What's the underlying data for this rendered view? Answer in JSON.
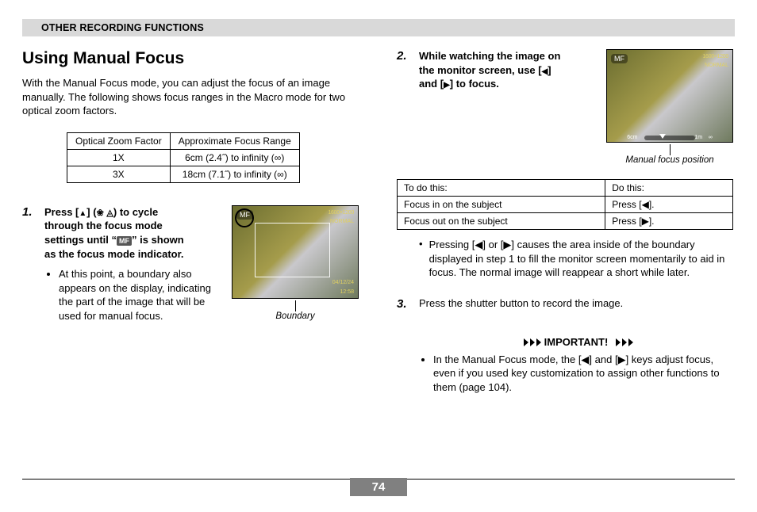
{
  "section_header": "OTHER RECORDING FUNCTIONS",
  "title": "Using Manual Focus",
  "intro": "With the Manual Focus mode, you can adjust the focus of an image manually. The following shows focus ranges in the Macro mode for two optical zoom factors.",
  "table1": {
    "head": [
      "Optical Zoom Factor",
      "Approximate Focus Range"
    ],
    "rows": [
      [
        "1X",
        "6cm (2.4˝) to infinity (∞)"
      ],
      [
        "3X",
        "18cm (7.1˝) to infinity (∞)"
      ]
    ]
  },
  "step1": {
    "num": "1.",
    "text_a": "Press [",
    "text_b": "] (",
    "text_c": ") to cycle through the focus mode settings until “",
    "text_d": "” is shown as the focus mode indicator.",
    "mf_glyph": "MF",
    "bullet": "At this point, a boundary also appears on the display, indicating the part of the image that will be used for manual focus."
  },
  "shot1": {
    "mf": "MF",
    "res": "1600×1200",
    "norm": "NORMAL",
    "date": "04/12/24",
    "time": "12:58",
    "count": "10",
    "caption": "Boundary"
  },
  "step2": {
    "num": "2.",
    "text_a": "While watching the image on the monitor screen, use [",
    "text_b": "] and [",
    "text_c": "] to focus."
  },
  "shot2": {
    "mf": "MF",
    "res": "1600×1200",
    "norm": "NORMAL",
    "scale_a": "6cm",
    "scale_b": "1m",
    "scale_c": "∞",
    "caption": "Manual focus position"
  },
  "table2": {
    "head": [
      "To do this:",
      "Do this:"
    ],
    "rows": [
      [
        "Focus in on the subject",
        "Press [◀]."
      ],
      [
        "Focus out on the subject",
        "Press [▶]."
      ]
    ]
  },
  "note_r": "Pressing [◀] or [▶] causes the area inside of the boundary displayed in step 1 to fill the monitor screen momentarily to aid in focus. The normal image will reappear a short while later.",
  "step3": {
    "num": "3.",
    "text": "Press the shutter button to record the image."
  },
  "important": {
    "label": "IMPORTANT!",
    "bullet": "In the Manual Focus mode, the [◀] and [▶] keys adjust focus, even if you used key customization to assign other functions to them (page 104)."
  },
  "page_number": "74"
}
